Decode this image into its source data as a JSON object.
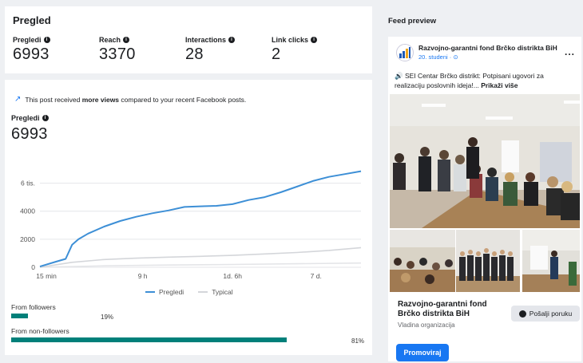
{
  "stats": {
    "title": "Pregled",
    "metrics": [
      {
        "label": "Pregledi",
        "value": "6993"
      },
      {
        "label": "Reach",
        "value": "3370"
      },
      {
        "label": "Interactions",
        "value": "28"
      },
      {
        "label": "Link clicks",
        "value": "2"
      }
    ]
  },
  "insight": {
    "prefix": "This post received ",
    "bold": "more views",
    "suffix": " compared to your recent Facebook posts."
  },
  "chart_metric": {
    "label": "Pregledi",
    "value": "6993"
  },
  "chart_data": {
    "type": "line",
    "title": "",
    "xlabel": "",
    "ylabel": "",
    "x_ticks": [
      "15 min",
      "9 h",
      "1d. 6h",
      "7 d."
    ],
    "y_ticks": [
      "0",
      "2000",
      "4000",
      "6 tis."
    ],
    "ylim": [
      0,
      7000
    ],
    "grid": true,
    "legend_position": "bottom",
    "series": [
      {
        "name": "Pregledi",
        "color": "#3d8fd6",
        "points": [
          [
            0,
            50
          ],
          [
            0.05,
            400
          ],
          [
            0.08,
            600
          ],
          [
            0.1,
            1600
          ],
          [
            0.12,
            2000
          ],
          [
            0.15,
            2400
          ],
          [
            0.2,
            2900
          ],
          [
            0.25,
            3300
          ],
          [
            0.3,
            3600
          ],
          [
            0.35,
            3850
          ],
          [
            0.4,
            4050
          ],
          [
            0.45,
            4300
          ],
          [
            0.5,
            4350
          ],
          [
            0.55,
            4380
          ],
          [
            0.6,
            4500
          ],
          [
            0.65,
            4800
          ],
          [
            0.7,
            5000
          ],
          [
            0.75,
            5350
          ],
          [
            0.8,
            5750
          ],
          [
            0.85,
            6150
          ],
          [
            0.9,
            6450
          ],
          [
            0.95,
            6650
          ],
          [
            1,
            6850
          ]
        ]
      },
      {
        "name": "Typical",
        "color": "#d4d6da",
        "points": [
          [
            0,
            0
          ],
          [
            0.1,
            350
          ],
          [
            0.2,
            550
          ],
          [
            0.3,
            650
          ],
          [
            0.4,
            720
          ],
          [
            0.5,
            780
          ],
          [
            0.6,
            850
          ],
          [
            0.7,
            950
          ],
          [
            0.8,
            1050
          ],
          [
            0.9,
            1200
          ],
          [
            1,
            1400
          ]
        ]
      },
      {
        "name": "",
        "color": "#e4e5e8",
        "points": [
          [
            0,
            0
          ],
          [
            0.2,
            100
          ],
          [
            0.4,
            160
          ],
          [
            0.6,
            200
          ],
          [
            0.8,
            250
          ],
          [
            1,
            300
          ]
        ]
      }
    ]
  },
  "legend": {
    "series1": "Pregledi",
    "series2": "Typical"
  },
  "audience": {
    "followers_label": "From followers",
    "followers_pct": "19%",
    "followers_value": 0.19,
    "nonfollowers_label": "From non-followers",
    "nonfollowers_pct": "81%",
    "nonfollowers_value": 0.81,
    "color": "#00807a"
  },
  "feed": {
    "title": "Feed preview",
    "page_name": "Razvojno-garantni fond Brčko distrikta BiH",
    "date": "20. studeni · ",
    "post_text_prefix": "🔊 SEI Centar Brčko distrikt: Potpisani ugovori za realizaciju poslovnih ideja!... ",
    "see_more": "Prikaži više",
    "promo_name": "Razvojno-garantni fond Brčko distrikta BiH",
    "promo_category": "Vladina organizacija",
    "message_button": "Pošalji poruku",
    "boost_button": "Promoviraj",
    "more_icon": "..."
  }
}
